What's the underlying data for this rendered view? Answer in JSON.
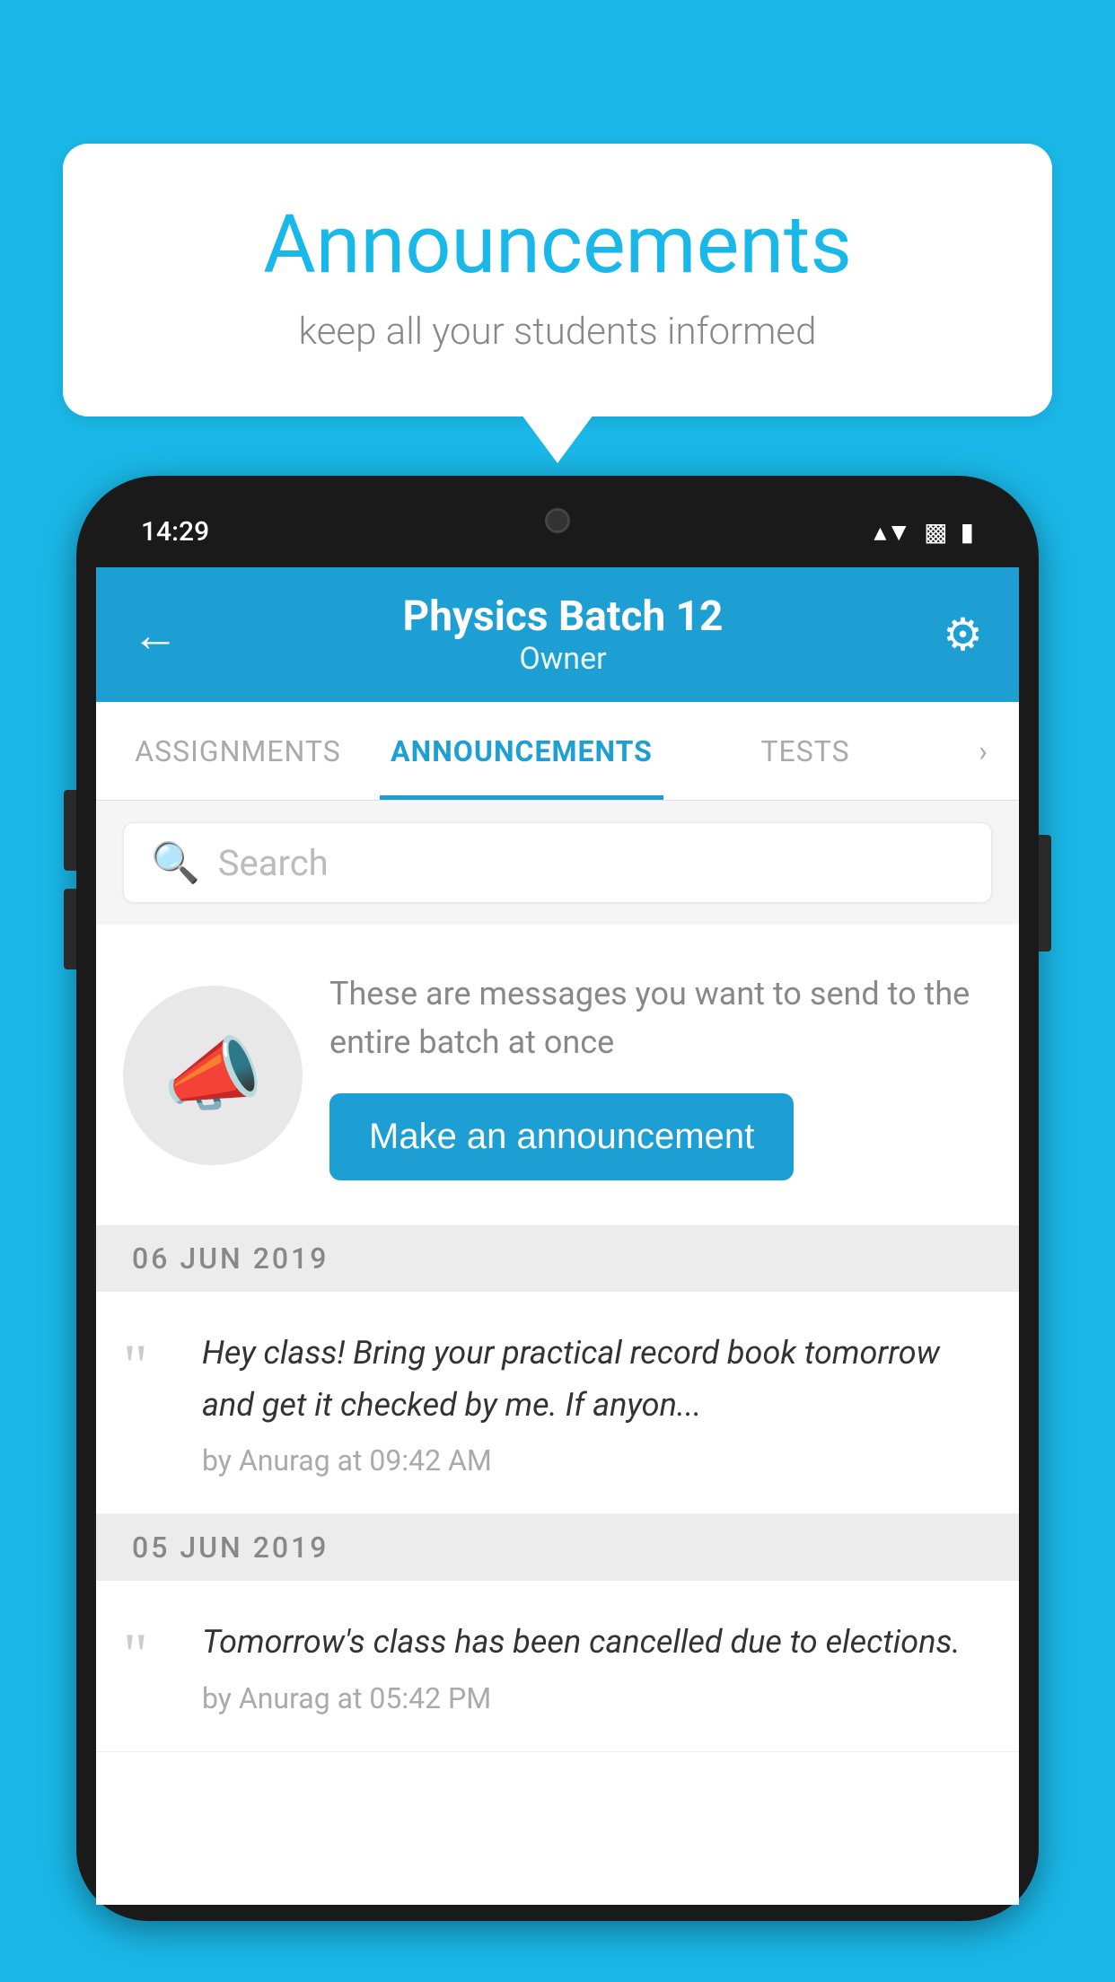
{
  "background_color": "#1ab8e8",
  "speech_bubble": {
    "title": "Announcements",
    "subtitle": "keep all your students informed"
  },
  "phone": {
    "status_bar": {
      "time": "14:29",
      "wifi": "▾",
      "signal": "▾",
      "battery": "▮"
    },
    "app_bar": {
      "back_label": "←",
      "title": "Physics Batch 12",
      "subtitle": "Owner",
      "settings_label": "⚙"
    },
    "tabs": [
      {
        "label": "ASSIGNMENTS",
        "active": false
      },
      {
        "label": "ANNOUNCEMENTS",
        "active": true
      },
      {
        "label": "TESTS",
        "active": false
      }
    ],
    "search": {
      "placeholder": "Search"
    },
    "cta": {
      "description": "These are messages you want to send to the entire batch at once",
      "button_label": "Make an announcement"
    },
    "date_groups": [
      {
        "date": "06  JUN  2019",
        "items": [
          {
            "text": "Hey class! Bring your practical record book tomorrow and get it checked by me. If anyon...",
            "meta": "by Anurag at 09:42 AM"
          }
        ]
      },
      {
        "date": "05  JUN  2019",
        "items": [
          {
            "text": "Tomorrow's class has been cancelled due to elections.",
            "meta": "by Anurag at 05:42 PM"
          }
        ]
      }
    ]
  }
}
